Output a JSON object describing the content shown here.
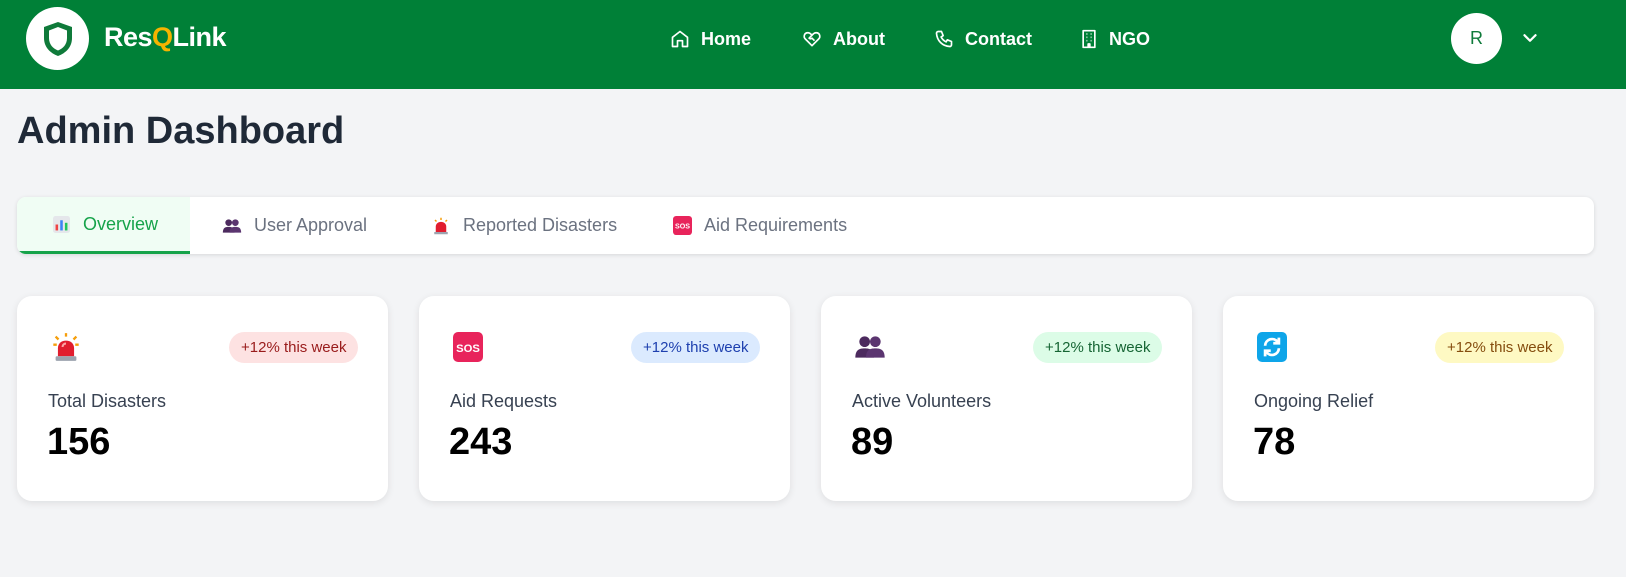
{
  "brand": {
    "name_prefix": "Res",
    "name_q": "Q",
    "name_suffix": "Link"
  },
  "nav": {
    "items": [
      {
        "label": "Home",
        "icon": "home-icon"
      },
      {
        "label": "About",
        "icon": "heart-handshake-icon"
      },
      {
        "label": "Contact",
        "icon": "phone-icon"
      },
      {
        "label": "NGO",
        "icon": "building-icon"
      }
    ],
    "avatar_initial": "R"
  },
  "page": {
    "title": "Admin Dashboard"
  },
  "tabs": [
    {
      "label": "Overview",
      "icon": "bar-chart-emoji-icon",
      "active": true
    },
    {
      "label": "User Approval",
      "icon": "people-emoji-icon",
      "active": false
    },
    {
      "label": "Reported Disasters",
      "icon": "siren-emoji-icon",
      "active": false
    },
    {
      "label": "Aid Requirements",
      "icon": "sos-emoji-icon",
      "active": false
    }
  ],
  "stats": [
    {
      "label": "Total Disasters",
      "value": "156",
      "badge": "+12% this week",
      "icon": "siren-emoji-icon",
      "badge_bg": "#fde2e2",
      "badge_color": "#991b1b"
    },
    {
      "label": "Aid Requests",
      "value": "243",
      "badge": "+12% this week",
      "icon": "sos-emoji-icon",
      "badge_bg": "#dbeafe",
      "badge_color": "#1e40af"
    },
    {
      "label": "Active Volunteers",
      "value": "89",
      "badge": "+12% this week",
      "icon": "people-emoji-icon",
      "badge_bg": "#dcfce7",
      "badge_color": "#166534"
    },
    {
      "label": "Ongoing Relief",
      "value": "78",
      "badge": "+12% this week",
      "icon": "refresh-emoji-icon",
      "badge_bg": "#fef9c3",
      "badge_color": "#854d0e"
    }
  ],
  "colors": {
    "navbar": "#008037",
    "accent": "#16a34a",
    "brand_q": "#f5b400"
  }
}
